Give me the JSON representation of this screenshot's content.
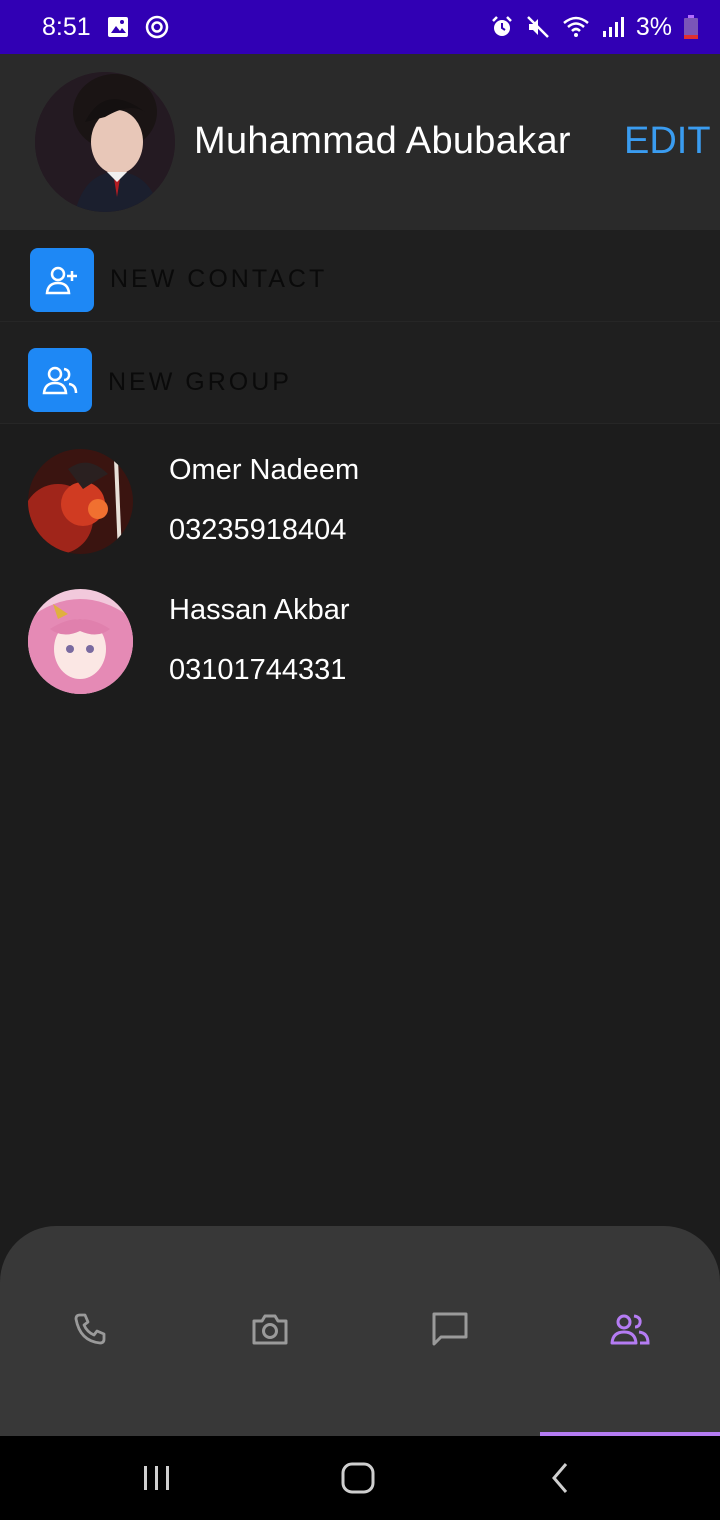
{
  "status_bar": {
    "time": "8:51",
    "battery_percent": "3%",
    "icons_left": [
      "gallery-icon",
      "sync-icon"
    ],
    "icons_right": [
      "alarm-icon",
      "mute-icon",
      "wifi-icon",
      "signal-icon",
      "battery-icon"
    ]
  },
  "profile": {
    "name": "Muhammad Abubakar",
    "edit_label": "EDIT"
  },
  "actions": {
    "new_contact": "NEW CONTACT",
    "new_group": "NEW GROUP"
  },
  "contacts": [
    {
      "name": "Omer Nadeem",
      "phone": "03235918404"
    },
    {
      "name": "Hassan Akbar",
      "phone": "03101744331"
    }
  ],
  "bottom_nav": {
    "tabs": [
      "calls",
      "camera",
      "chats",
      "contacts"
    ],
    "active_tab": "contacts"
  },
  "colors": {
    "status_bar": "#3100b4",
    "accent_blue": "#3a9cf0",
    "action_icon_bg": "#1e88f5",
    "active_tab": "#b57cf3",
    "background": "#1c1c1c"
  }
}
